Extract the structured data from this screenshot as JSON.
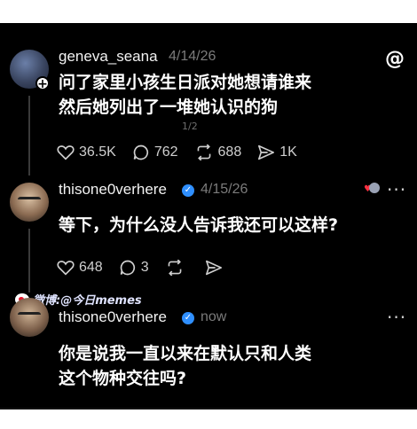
{
  "posts": [
    {
      "username": "geneva_seana",
      "date": "4/14/26",
      "text_line1": "问了家里小孩生日派对她想请谁来",
      "text_line2": "然后她列出了一堆她认识的狗",
      "pager": "1/2",
      "stats": {
        "likes": "36.5K",
        "comments": "762",
        "reposts": "688",
        "shares": "1K"
      }
    },
    {
      "username": "thisone0verhere",
      "date": "4/15/26",
      "text": "等下，为什么没人告诉我还可以这样?",
      "stats": {
        "likes": "648",
        "comments": "3"
      }
    },
    {
      "username": "thisone0verhere",
      "date": "now",
      "text_line1": "你是说我一直以来在默认只和人类",
      "text_line2": "这个物种交往吗?"
    }
  ],
  "watermark": "微博:@今日memes",
  "icons": {
    "threads": "threads-logo-icon",
    "verified": "verified-badge-icon"
  },
  "colors": {
    "background": "#000000",
    "text": "#ffffff",
    "muted": "#7b7b7b",
    "verified": "#2f8fff"
  }
}
